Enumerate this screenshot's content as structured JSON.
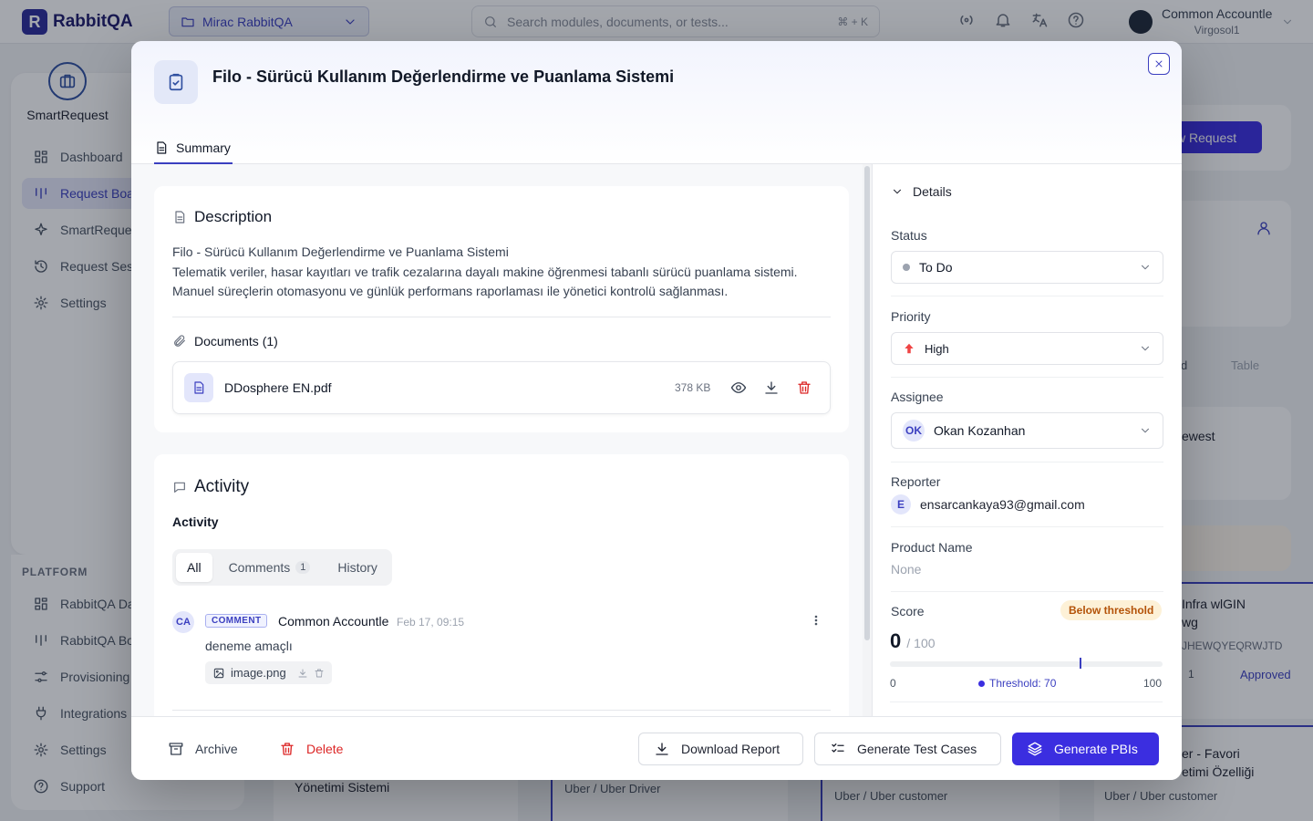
{
  "app": {
    "brand": "RabbitQA",
    "workspace": "Mirac RabbitQA",
    "search_placeholder": "Search modules, documents, or tests...",
    "search_shortcut": "⌘ + K",
    "user_name": "Common Accountle",
    "user_org": "Virgosol1"
  },
  "sidebar": {
    "brand": "SmartRequest",
    "items": [
      {
        "label": "Dashboard",
        "icon": "grid-icon"
      },
      {
        "label": "Request Boa",
        "icon": "board-icon"
      },
      {
        "label": "SmartReque",
        "icon": "sparkle-icon"
      },
      {
        "label": "Request Ses",
        "icon": "history-icon"
      },
      {
        "label": "Settings",
        "icon": "gear-icon"
      }
    ],
    "platform_title": "PLATFORM",
    "platform_items": [
      {
        "label": "RabbitQA Da",
        "icon": "grid-icon"
      },
      {
        "label": "RabbitQA Bo",
        "icon": "board-icon"
      },
      {
        "label": "Provisioning",
        "icon": "sliders-icon"
      },
      {
        "label": "Integrations",
        "icon": "plug-icon"
      },
      {
        "label": "Settings",
        "icon": "gear-icon"
      },
      {
        "label": "Support",
        "icon": "help-icon"
      }
    ]
  },
  "background": {
    "new_request": "w Request",
    "view_d": "d",
    "view_table": "Table",
    "sort_value": "ewest",
    "card1_title": "Infra wlGIN",
    "card1_sub": "wg",
    "card1_code": "JHEWQYEQRWJTD",
    "card1_count": "1",
    "card1_status": "Approved",
    "card2_title": "er - Favori",
    "card2_sub": "etimi Özelliği",
    "b1": "Yönetimi Sistemi",
    "b2": "Uber / Uber Driver",
    "b3": "Uber / Uber customer",
    "b4": "Uber / Uber customer"
  },
  "modal": {
    "title": "Filo - Sürücü Kullanım Değerlendirme ve Puanlama Sistemi",
    "tab_summary": "Summary",
    "description": {
      "heading": "Description",
      "lines": [
        "Filo - Sürücü Kullanım Değerlendirme ve Puanlama Sistemi",
        "Telematik veriler, hasar kayıtları ve trafik cezalarına dayalı makine öğrenmesi tabanlı sürücü puanlama sistemi.",
        "Manuel süreçlerin otomasyonu ve günlük performans raporlaması ile yönetici kontrolü sağlanması."
      ]
    },
    "documents": {
      "heading": "Documents (1)",
      "items": [
        {
          "name": "DDosphere EN.pdf",
          "size": "378 KB"
        }
      ]
    },
    "activity": {
      "heading": "Activity",
      "subheading": "Activity",
      "tabs": {
        "all": "All",
        "comments": "Comments",
        "comments_count": "1",
        "history": "History"
      },
      "comment": {
        "avatar": "CA",
        "tag": "COMMENT",
        "author": "Common Accountle",
        "time": "Feb 17, 09:15",
        "text": "deneme amaçlı",
        "attachment": "image.png"
      }
    },
    "details": {
      "heading": "Details",
      "status_label": "Status",
      "status_value": "To Do",
      "priority_label": "Priority",
      "priority_value": "High",
      "assignee_label": "Assignee",
      "assignee_initials": "OK",
      "assignee_value": "Okan Kozanhan",
      "reporter_label": "Reporter",
      "reporter_initial": "E",
      "reporter_value": "ensarcankaya93@gmail.com",
      "product_label": "Product Name",
      "product_value": "None",
      "score_label": "Score",
      "score_badge": "Below threshold",
      "score_value": "0",
      "score_max": "/ 100",
      "score_fraction": 0,
      "threshold_fraction": 0.7,
      "scale_min": "0",
      "scale_threshold": "Threshold: 70",
      "scale_max": "100"
    },
    "footer": {
      "archive": "Archive",
      "delete": "Delete",
      "download_report": "Download Report",
      "generate_tests": "Generate Test Cases",
      "generate_pbis": "Generate PBIs"
    },
    "colors": {
      "primary": "#3b2ee0",
      "danger": "#dc2626",
      "warning": "#b45309"
    }
  }
}
